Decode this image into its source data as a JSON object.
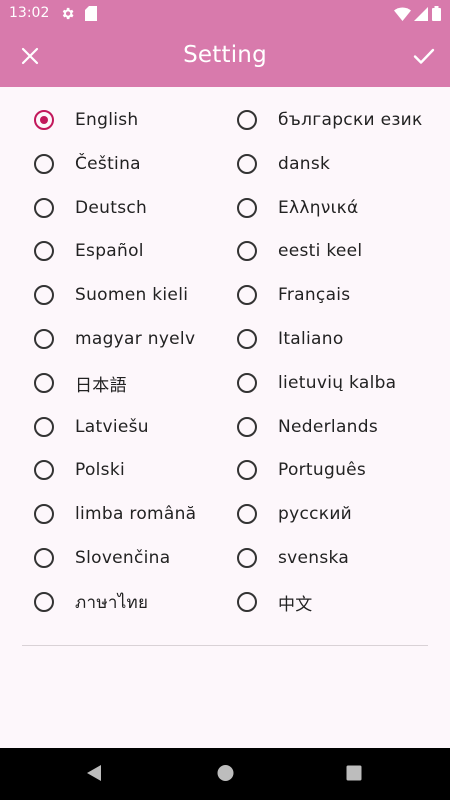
{
  "status_bar": {
    "time": "13:02",
    "icons": [
      "settings-icon",
      "sd-card-icon",
      "wifi-icon",
      "signal-icon",
      "battery-icon"
    ]
  },
  "app_bar": {
    "title": "Setting",
    "close_icon": "close-icon",
    "confirm_icon": "check-icon",
    "background": "#d87aac"
  },
  "languages": {
    "left": [
      {
        "label": "English",
        "selected": true
      },
      {
        "label": "Čeština",
        "selected": false
      },
      {
        "label": "Deutsch",
        "selected": false
      },
      {
        "label": "Español",
        "selected": false
      },
      {
        "label": "Suomen kieli",
        "selected": false
      },
      {
        "label": "magyar nyelv",
        "selected": false
      },
      {
        "label": "日本語",
        "selected": false
      },
      {
        "label": "Latviešu",
        "selected": false
      },
      {
        "label": "Polski",
        "selected": false
      },
      {
        "label": "limba română",
        "selected": false
      },
      {
        "label": "Slovenčina",
        "selected": false
      },
      {
        "label": "ภาษาไทย",
        "selected": false
      }
    ],
    "right": [
      {
        "label": "български език",
        "selected": false
      },
      {
        "label": "dansk",
        "selected": false
      },
      {
        "label": "Ελληνικά",
        "selected": false
      },
      {
        "label": "eesti keel",
        "selected": false
      },
      {
        "label": "Français",
        "selected": false
      },
      {
        "label": "Italiano",
        "selected": false
      },
      {
        "label": "lietuvių kalba",
        "selected": false
      },
      {
        "label": "Nederlands",
        "selected": false
      },
      {
        "label": "Português",
        "selected": false
      },
      {
        "label": "русский",
        "selected": false
      },
      {
        "label": "svenska",
        "selected": false
      },
      {
        "label": "中文",
        "selected": false
      }
    ],
    "accent": "#c2185b"
  },
  "nav_bar": {
    "icons": [
      "back-icon",
      "home-icon",
      "recents-icon"
    ]
  }
}
